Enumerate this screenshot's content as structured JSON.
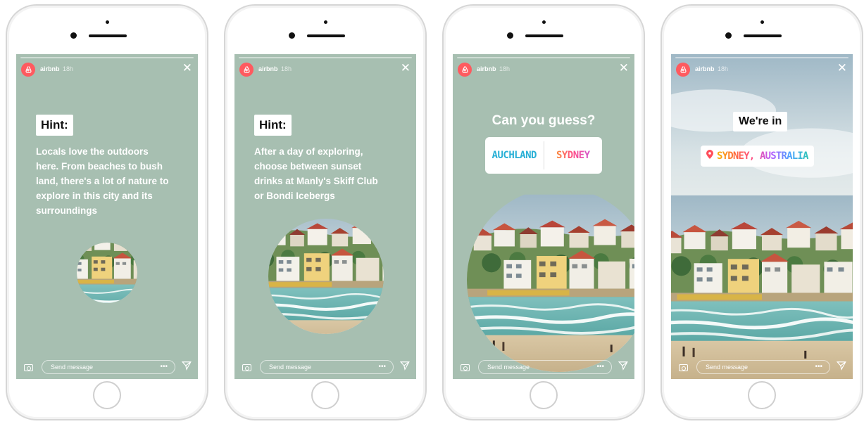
{
  "colors": {
    "story_bg": "#a7bfb1",
    "brand": "#ff5a5f",
    "rainbow": [
      "#f7b500",
      "#ff6a3d",
      "#ff4d8a",
      "#b45cff",
      "#4aa3ff",
      "#2ec4b6",
      "#6cd36b"
    ]
  },
  "screens": [
    {
      "account": "airbnb",
      "time": "18h",
      "hint_label": "Hint:",
      "hint_text": "Locals love the outdoors here. From beaches to bush land, there's a lot of nature to explore in this city and its surroundings",
      "message_placeholder": "Send message"
    },
    {
      "account": "airbnb",
      "time": "18h",
      "hint_label": "Hint:",
      "hint_text": "After a day of exploring, choose between sunset drinks at Manly's Skiff Club or Bondi Icebergs",
      "message_placeholder": "Send message"
    },
    {
      "account": "airbnb",
      "time": "18h",
      "question": "Can you guess?",
      "poll_options": [
        "AUCHLAND",
        "SYDNEY"
      ],
      "message_placeholder": "Send message"
    },
    {
      "account": "airbnb",
      "time": "18h",
      "title": "We're in",
      "location": "SYDNEY, AUSTRALIA",
      "message_placeholder": "Send message"
    }
  ],
  "icons": [
    "airbnb-logo-icon",
    "close-icon",
    "camera-icon",
    "more-icon",
    "direct-send-icon",
    "location-pin-icon"
  ]
}
